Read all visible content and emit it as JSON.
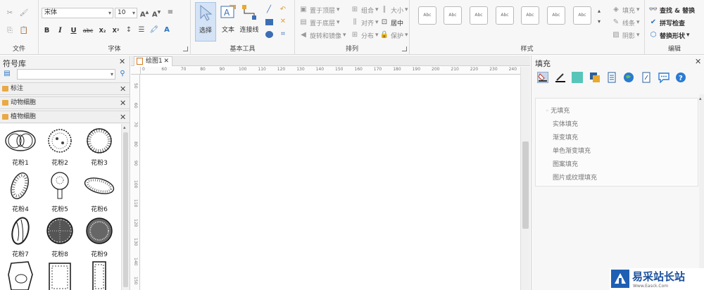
{
  "ribbon": {
    "file": {
      "label": "文件"
    },
    "font": {
      "label": "字体",
      "font_name": "宋体",
      "font_size": "10",
      "buttons": [
        "B",
        "I",
        "U",
        "abc",
        "X₂",
        "X²"
      ]
    },
    "tools": {
      "label": "基本工具",
      "select": "选择",
      "text": "文本",
      "connector": "连接线"
    },
    "arrange": {
      "label": "排列",
      "bring_front": "置于顶层",
      "send_back": "置于底层",
      "rotate_mirror": "旋转和镜像",
      "group": "组合",
      "align": "对齐",
      "distribute": "分布",
      "size": "大小",
      "center": "居中",
      "protect": "保护"
    },
    "styles": {
      "label": "样式",
      "boxes": [
        "Abc",
        "Abc",
        "Abc",
        "Abc",
        "Abc",
        "Abc",
        "Abc"
      ],
      "fill": "填充",
      "line": "线条",
      "shadow": "阴影"
    },
    "edit": {
      "label": "编辑",
      "find_replace": "查找 & 替换",
      "spell_check": "拼写检查",
      "replace_shape": "替换形状"
    }
  },
  "left_panel": {
    "title": "符号库",
    "categories": [
      "标注",
      "动物细胞",
      "植物细胞"
    ],
    "shapes": [
      "花粉1",
      "花粉2",
      "花粉3",
      "花粉4",
      "花粉5",
      "花粉6",
      "花粉7",
      "花粉8",
      "花粉9"
    ]
  },
  "document": {
    "tab": "绘图1",
    "hruler": [
      "0",
      "60",
      "70",
      "80",
      "90",
      "100",
      "110",
      "120",
      "130",
      "140",
      "150",
      "160",
      "170",
      "180",
      "190",
      "200",
      "210",
      "220",
      "230",
      "240"
    ],
    "vruler": [
      "50",
      "60",
      "70",
      "80",
      "90",
      "100",
      "110",
      "120",
      "130",
      "140",
      "150"
    ]
  },
  "right_panel": {
    "title": "填充",
    "options": [
      "无填充",
      "实体填充",
      "渐变填充",
      "单色渐变填充",
      "图案填充",
      "图片或纹理填充"
    ]
  },
  "watermark": {
    "text": "易采站长站",
    "url": "Www.Easck.Com"
  }
}
